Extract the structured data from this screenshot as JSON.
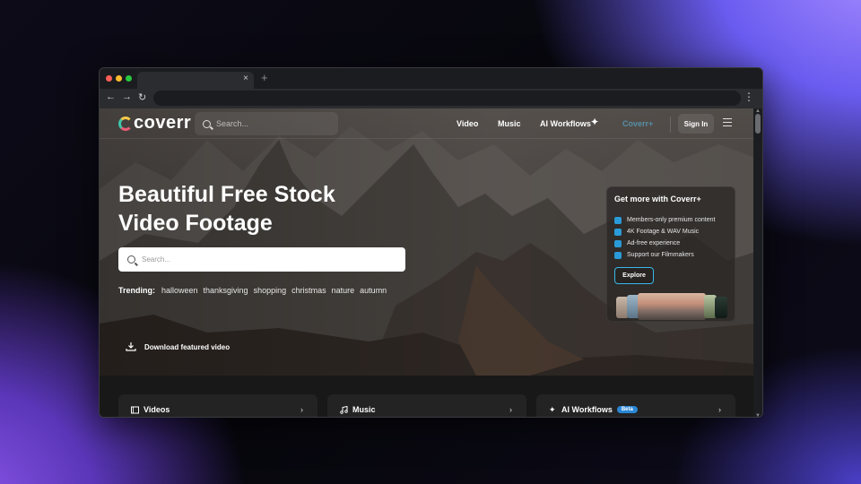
{
  "site": {
    "logo_text": "coverr",
    "header_search_placeholder": "Search...",
    "nav": [
      "Video",
      "Music",
      "AI Workflows",
      "Coverr+"
    ],
    "signin_label": "Sign In"
  },
  "hero": {
    "title_line1": "Beautiful Free Stock",
    "title_line2": "Video Footage",
    "search_placeholder": "Search...",
    "trending_label": "Trending:",
    "trending_tags": [
      "halloween",
      "thanksgiving",
      "shopping",
      "christmas",
      "nature",
      "autumn"
    ],
    "download_label": "Download featured video"
  },
  "promo": {
    "title": "Get more with Coverr+",
    "items": [
      "Members-only premium content",
      "4K Footage & WAV Music",
      "Ad-free experience",
      "Support our Filmmakers"
    ],
    "explore_label": "Explore"
  },
  "sections": [
    {
      "title": "Videos",
      "icon": "film-icon"
    },
    {
      "title": "Music",
      "icon": "music-note-icon"
    },
    {
      "title": "AI Workflows",
      "icon": "sparkle-icon",
      "badge": "Beta"
    }
  ],
  "browser": {
    "tab_close": "×",
    "new_tab": "+"
  },
  "colors": {
    "accent": "#39b7e9",
    "beta_badge": "#2a86d6"
  }
}
